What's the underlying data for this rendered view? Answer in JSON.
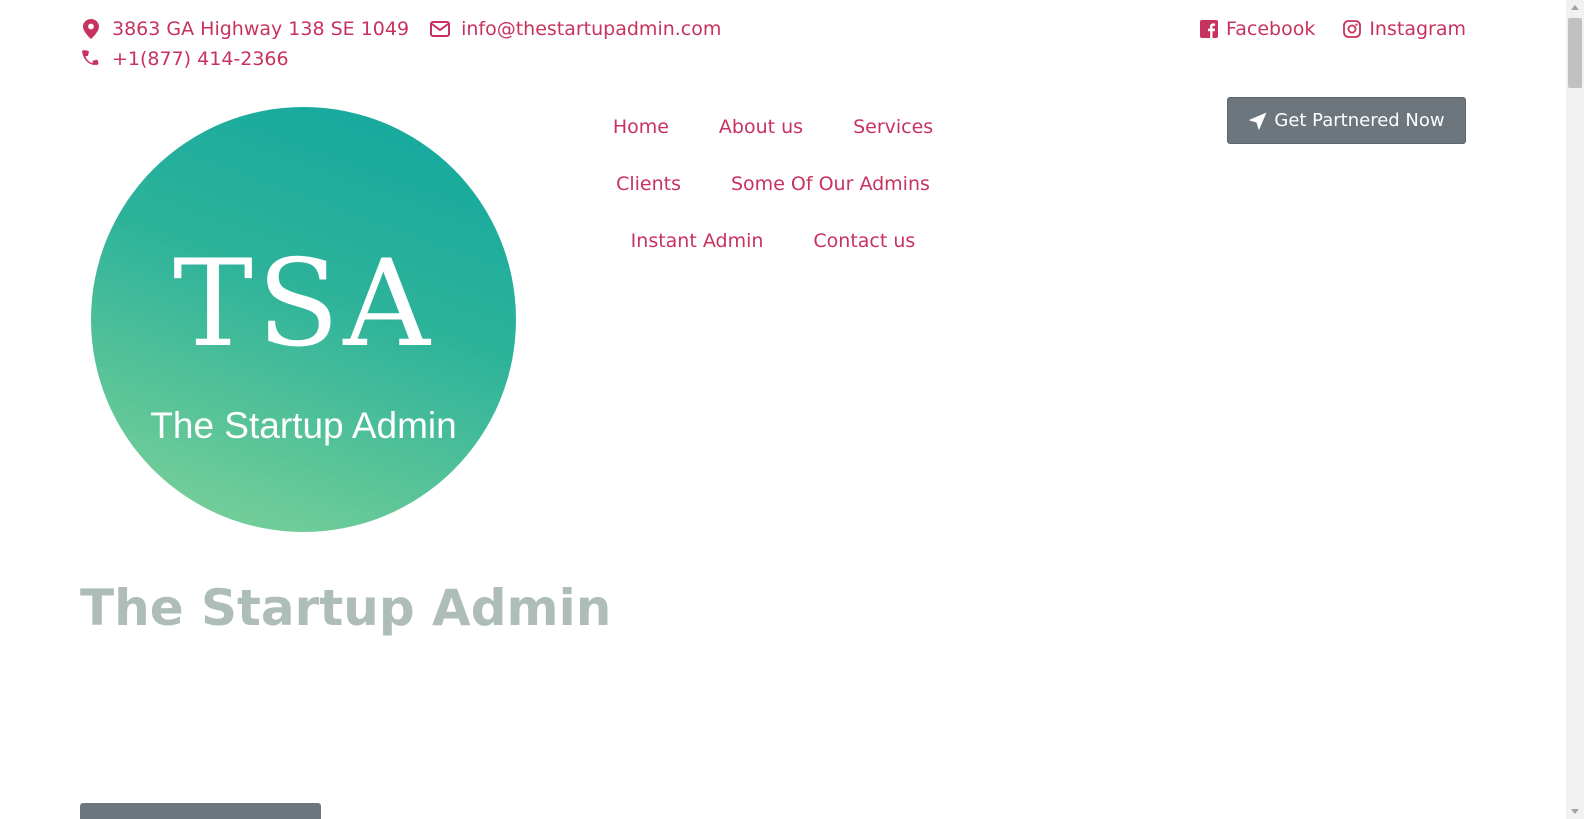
{
  "contact": {
    "address": "3863 GA Highway 138 SE 1049",
    "email": "info@thestartupadmin.com",
    "phone": "+1(877) 414-2366",
    "icons": {
      "address": "map-marker-icon",
      "email": "envelope-icon",
      "phone": "phone-icon"
    }
  },
  "social": {
    "facebook_label": "Facebook",
    "instagram_label": "Instagram",
    "icons": {
      "facebook": "facebook-square-icon",
      "instagram": "instagram-icon"
    }
  },
  "logo": {
    "mark": "TSA",
    "name": "The Startup Admin"
  },
  "nav": {
    "items": [
      {
        "label": "Home"
      },
      {
        "label": "About us"
      },
      {
        "label": "Services"
      },
      {
        "label": "Clients"
      },
      {
        "label": "Some Of Our Admins"
      },
      {
        "label": "Instant Admin"
      },
      {
        "label": "Contact us"
      }
    ]
  },
  "cta": {
    "label": "Get Partnered Now",
    "icon": "paper-plane-icon"
  },
  "hero": {
    "title": "The Startup Admin"
  },
  "colors": {
    "accent": "#c8325f",
    "button_bg": "#6d757d",
    "title": "#aebdb8",
    "logo_gradient_start": "#0fa79e",
    "logo_gradient_end": "#83d497"
  }
}
